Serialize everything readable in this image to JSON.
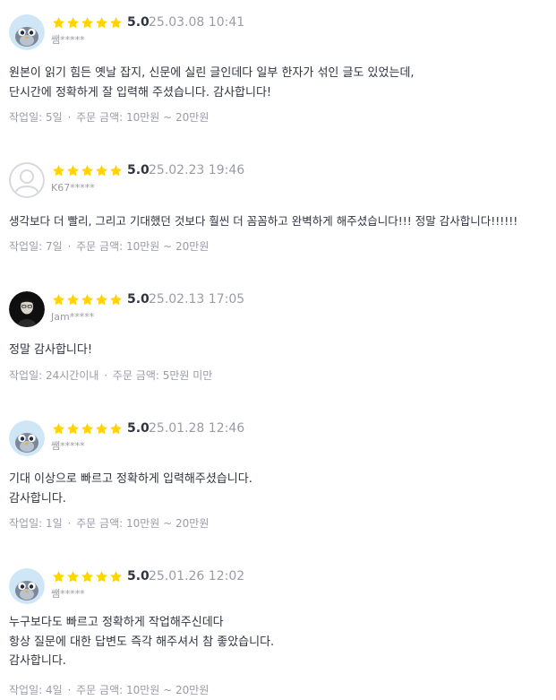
{
  "star_color": "#FFD400",
  "meta_separator": "·",
  "reviews": [
    {
      "avatar": "bird-icon",
      "score": "5.0",
      "date": "25.03.08 10:41",
      "user": "쌤*****",
      "lines": [
        "원본이 읽기 힘든 옛날 잡지, 신문에 실린 글인데다 일부 한자가 섞인 글도 있었는데,",
        "단시간에 정확하게 잘 입력해 주셨습니다. 감사합니다!"
      ],
      "work_period": "작업일: 5일",
      "order_amount": "주문 금액: 10만원 ~ 20만원"
    },
    {
      "avatar": "default-user-icon",
      "score": "5.0",
      "date": "25.02.23 19:46",
      "user": "K67*****",
      "lines": [
        "생각보다 더 빨리, 그리고 기대했던 것보다 훨씬 더 꼼꼼하고 완벽하게 해주셨습니다!!! 정말 감사합니다!!!!!!"
      ],
      "work_period": "작업일: 7일",
      "order_amount": "주문 금액: 10만원 ~ 20만원"
    },
    {
      "avatar": "person-photo",
      "score": "5.0",
      "date": "25.02.13 17:05",
      "user": "Jam*****",
      "lines": [
        "정말 감사합니다!"
      ],
      "work_period": "작업일: 24시간이내",
      "order_amount": "주문 금액: 5만원 미만"
    },
    {
      "avatar": "bird-icon",
      "score": "5.0",
      "date": "25.01.28 12:46",
      "user": "쌤*****",
      "lines": [
        "기대 이상으로 빠르고 정확하게 입력해주셨습니다.",
        "감사합니다."
      ],
      "work_period": "작업일: 1일",
      "order_amount": "주문 금액: 10만원 ~ 20만원"
    },
    {
      "avatar": "bird-icon",
      "score": "5.0",
      "date": "25.01.26 12:02",
      "user": "쌤*****",
      "lines": [
        "누구보다도 빠르고 정확하게 작업해주신데다",
        "항상 질문에 대한 답변도 즉각 해주셔서 참 좋았습니다.",
        "감사합니다."
      ],
      "work_period": "작업일: 4일",
      "order_amount": "주문 금액: 10만원 ~ 20만원"
    }
  ]
}
